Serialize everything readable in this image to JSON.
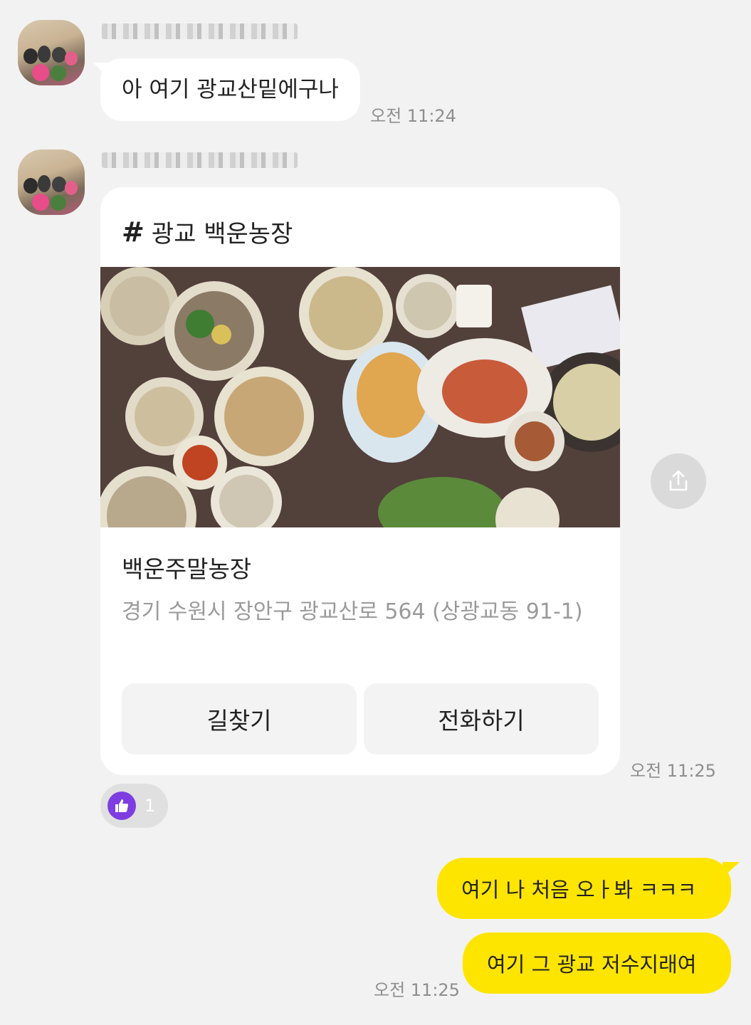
{
  "messages": [
    {
      "text": "아 여기 광교산밑에구나",
      "time": "오전 11:24"
    },
    {
      "time": "오전 11:25"
    }
  ],
  "place_card": {
    "hashtag": "#",
    "title": "광교 백운농장",
    "name": "백운주말농장",
    "address": "경기 수원시 장안구 광교산로 564 (상광교동 91-1)",
    "buttons": {
      "directions": "길찾기",
      "call": "전화하기"
    }
  },
  "reaction": {
    "icon": "thumbs-up-icon",
    "count": "1"
  },
  "my_messages": [
    {
      "text": "여기 나 처음 오ㅏ봐 ㅋㅋㅋ"
    },
    {
      "text": "여기 그 광교 저수지래여",
      "time": "오전 11:25"
    }
  ],
  "colors": {
    "background": "#f2f2f2",
    "my_bubble": "#fee500",
    "reaction": "#7d3de0"
  }
}
